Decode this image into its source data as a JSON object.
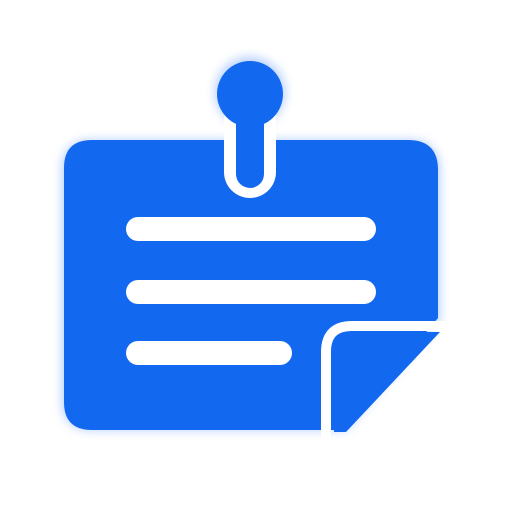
{
  "icon": {
    "name": "pinned-note-icon",
    "colors": {
      "background": "#ffffff",
      "note": "#1368f0",
      "lines": "#ffffff",
      "glow": "#9cc0ff"
    }
  }
}
